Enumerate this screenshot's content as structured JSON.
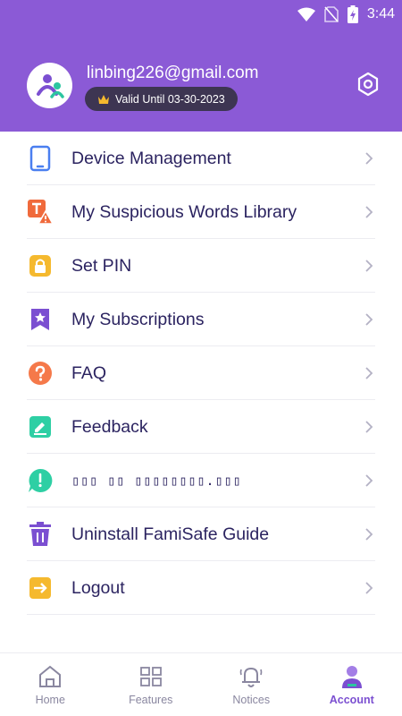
{
  "status_bar": {
    "time": "3:44"
  },
  "profile": {
    "email": "linbing226@gmail.com",
    "validity": "Valid Until 03-30-2023"
  },
  "menu": {
    "items": [
      {
        "label": "Device Management",
        "icon": "tablet-icon"
      },
      {
        "label": "My Suspicious Words Library",
        "icon": "text-warning-icon"
      },
      {
        "label": "Set PIN",
        "icon": "lock-icon"
      },
      {
        "label": "My Subscriptions",
        "icon": "star-bookmark-icon"
      },
      {
        "label": "FAQ",
        "icon": "question-icon"
      },
      {
        "label": "Feedback",
        "icon": "edit-icon"
      },
      {
        "label": "▯▯▯ ▯▯ ▯▯▯▯▯▯▯▯.▯▯▯",
        "icon": "chat-alert-icon"
      },
      {
        "label": "Uninstall FamiSafe Guide",
        "icon": "trash-icon"
      },
      {
        "label": "Logout",
        "icon": "logout-icon"
      }
    ]
  },
  "bottom_nav": {
    "tabs": [
      {
        "label": "Home",
        "active": false
      },
      {
        "label": "Features",
        "active": false
      },
      {
        "label": "Notices",
        "active": false
      },
      {
        "label": "Account",
        "active": true
      }
    ]
  },
  "colors": {
    "brand_purple": "#8b5ad6",
    "text_dark": "#2b2360",
    "active_tab": "#7b4fd1"
  }
}
